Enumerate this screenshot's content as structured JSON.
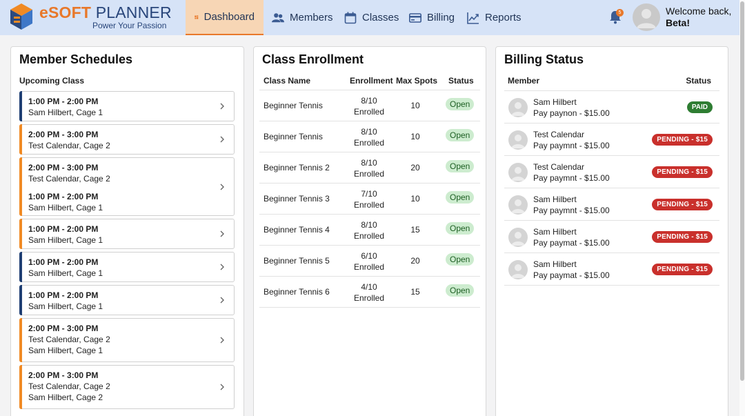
{
  "brand": {
    "name_part1": "eSOFT",
    "name_part2": " PLANNER",
    "tagline": "Power Your Passion"
  },
  "nav": [
    {
      "label": "Dashboard",
      "icon": "dashboard-icon"
    },
    {
      "label": "Members",
      "icon": "members-icon"
    },
    {
      "label": "Classes",
      "icon": "calendar-icon"
    },
    {
      "label": "Billing",
      "icon": "credit-card-icon"
    },
    {
      "label": "Reports",
      "icon": "chart-icon"
    }
  ],
  "notifications": {
    "count": "5"
  },
  "user": {
    "greeting": "Welcome back,",
    "name": "Beta!"
  },
  "member_schedules": {
    "title": "Member Schedules",
    "subheading": "Upcoming Class",
    "cards": [
      {
        "color": "#1f3f73",
        "entries": [
          {
            "time": "1:00 PM - 2:00 PM",
            "who": "Sam Hilbert, Cage 1"
          }
        ]
      },
      {
        "color": "#f08a24",
        "entries": [
          {
            "time": "2:00 PM - 3:00 PM",
            "who": "Test Calendar, Cage 2"
          }
        ]
      },
      {
        "color": "#f08a24",
        "entries": [
          {
            "time": "2:00 PM - 3:00 PM",
            "who": "Test Calendar, Cage 2"
          },
          {
            "time": "1:00 PM - 2:00 PM",
            "who": "Sam Hilbert, Cage 1"
          }
        ]
      },
      {
        "color": "#f08a24",
        "entries": [
          {
            "time": "1:00 PM - 2:00 PM",
            "who": "Sam Hilbert, Cage 1"
          }
        ]
      },
      {
        "color": "#1f3f73",
        "entries": [
          {
            "time": "1:00 PM - 2:00 PM",
            "who": "Sam Hilbert, Cage 1"
          }
        ]
      },
      {
        "color": "#1f3f73",
        "entries": [
          {
            "time": "1:00 PM - 2:00 PM",
            "who": "Sam Hilbert, Cage 1"
          }
        ]
      },
      {
        "color": "#f08a24",
        "entries": [
          {
            "time": "2:00 PM - 3:00 PM",
            "who": "Test Calendar, Cage 2",
            "who2": "Sam Hilbert, Cage 1"
          }
        ]
      },
      {
        "color": "#f08a24",
        "entries": [
          {
            "time": "2:00 PM - 3:00 PM",
            "who": "Test Calendar, Cage 2",
            "who2": "Sam Hilbert, Cage 2"
          }
        ]
      }
    ]
  },
  "class_enrollment": {
    "title": "Class Enrollment",
    "columns": [
      "Class Name",
      "Enrollment",
      "Max Spots",
      "Status"
    ],
    "rows": [
      {
        "name": "Beginner Tennis",
        "enrolled": "8/10",
        "enrolled_label": "Enrolled",
        "max": "10",
        "status": "Open"
      },
      {
        "name": "Beginner Tennis",
        "enrolled": "8/10",
        "enrolled_label": "Enrolled",
        "max": "10",
        "status": "Open"
      },
      {
        "name": "Beginner Tennis 2",
        "enrolled": "8/10",
        "enrolled_label": "Enrolled",
        "max": "20",
        "status": "Open"
      },
      {
        "name": "Beginner Tennis 3",
        "enrolled": "7/10",
        "enrolled_label": "Enrolled",
        "max": "10",
        "status": "Open"
      },
      {
        "name": "Beginner Tennis 4",
        "enrolled": "8/10",
        "enrolled_label": "Enrolled",
        "max": "15",
        "status": "Open"
      },
      {
        "name": "Beginner Tennis 5",
        "enrolled": "6/10",
        "enrolled_label": "Enrolled",
        "max": "20",
        "status": "Open"
      },
      {
        "name": "Beginner Tennis 6",
        "enrolled": "4/10",
        "enrolled_label": "Enrolled",
        "max": "15",
        "status": "Open"
      }
    ]
  },
  "billing_status": {
    "title": "Billing Status",
    "columns": [
      "Member",
      "Status"
    ],
    "rows": [
      {
        "member": "Sam Hilbert",
        "detail": "Pay paynon - $15.00",
        "status": "PAID",
        "kind": "paid"
      },
      {
        "member": "Test Calendar",
        "detail": "Pay paymnt - $15.00",
        "status": "PENDING - $15",
        "kind": "pending"
      },
      {
        "member": "Test Calendar",
        "detail": "Pay paymnt - $15.00",
        "status": "PENDING - $15",
        "kind": "pending"
      },
      {
        "member": "Sam Hilbert",
        "detail": "Pay paymnt - $15.00",
        "status": "PENDING - $15",
        "kind": "pending"
      },
      {
        "member": "Sam Hilbert",
        "detail": "Pay paymat - $15.00",
        "status": "PENDING - $15",
        "kind": "pending"
      },
      {
        "member": "Sam Hilbert",
        "detail": "Pay paymat - $15.00",
        "status": "PENDING - $15",
        "kind": "pending"
      }
    ]
  },
  "colors": {
    "accent": "#e8782a",
    "nav_text": "#1f3355",
    "header_bg": "#d6e3f7",
    "open_pill": "#cdeccf",
    "paid": "#2e7d32",
    "pending": "#c9302c"
  }
}
